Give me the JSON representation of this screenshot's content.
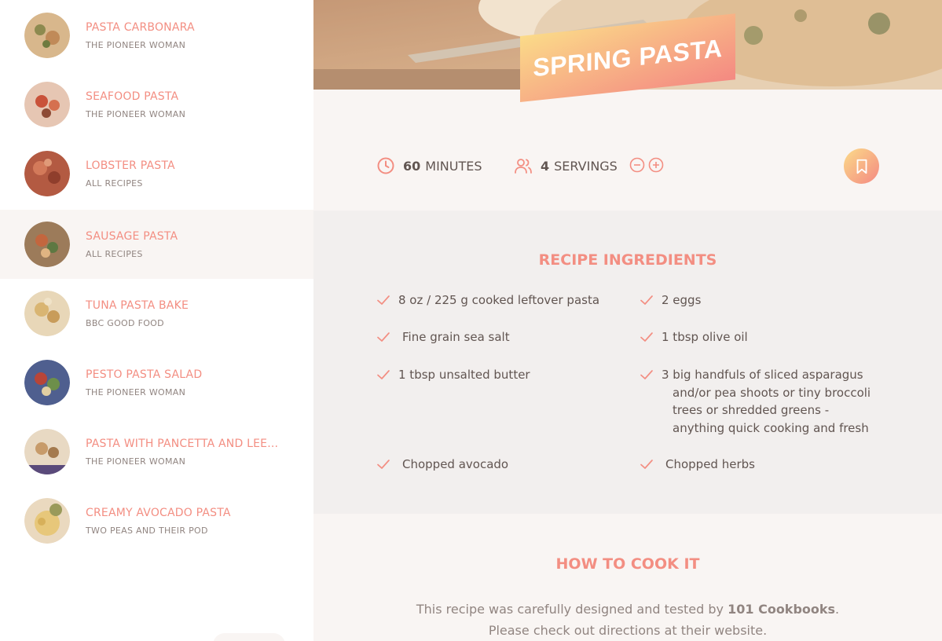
{
  "results": [
    {
      "title": "Pasta Carbonara",
      "publisher": "The Pioneer Woman",
      "active": false
    },
    {
      "title": "Seafood Pasta",
      "publisher": "The Pioneer Woman",
      "active": false
    },
    {
      "title": "Lobster Pasta",
      "publisher": "All Recipes",
      "active": false
    },
    {
      "title": "Sausage Pasta",
      "publisher": "All Recipes",
      "active": true
    },
    {
      "title": "Tuna Pasta Bake",
      "publisher": "BBC Good Food",
      "active": false
    },
    {
      "title": "Pesto Pasta Salad",
      "publisher": "The Pioneer Woman",
      "active": false
    },
    {
      "title": "Pasta with Pancetta and Lee...",
      "publisher": "The Pioneer Woman",
      "active": false
    },
    {
      "title": "Creamy Avocado Pasta",
      "publisher": "Two Peas and Their Pod",
      "active": false
    }
  ],
  "recipe": {
    "title": "Spring Pasta",
    "time_value": "60",
    "time_unit": "minutes",
    "servings_value": "4",
    "servings_unit": "servings",
    "icons": {
      "time": "clock-icon",
      "servings": "users-icon",
      "decrease": "minus-circle-icon",
      "increase": "plus-circle-icon",
      "bookmark": "bookmark-icon",
      "check": "check-icon"
    }
  },
  "ingredients": {
    "heading": "Recipe ingredients",
    "items": [
      "8 oz / 225 g cooked leftover pasta",
      "2 eggs",
      "Fine grain sea salt",
      "1 tbsp olive oil",
      "1 tbsp unsalted butter",
      "3 big handfuls of sliced asparagus and/or pea shoots or tiny broccoli trees or shredded greens - anything quick cooking and fresh",
      "Chopped avocado",
      "Chopped herbs"
    ]
  },
  "howto": {
    "heading": "How to cook it",
    "text_before": "This recipe was carefully designed and tested by ",
    "publisher": "101 Cookbooks",
    "text_after": ". Please check out directions at their website."
  },
  "colors": {
    "accent": "#f38e82",
    "gradient_start": "#fbdb89",
    "gradient_end": "#f48982",
    "panel": "#f9f5f3",
    "ingredients_bg": "#f2efee"
  }
}
